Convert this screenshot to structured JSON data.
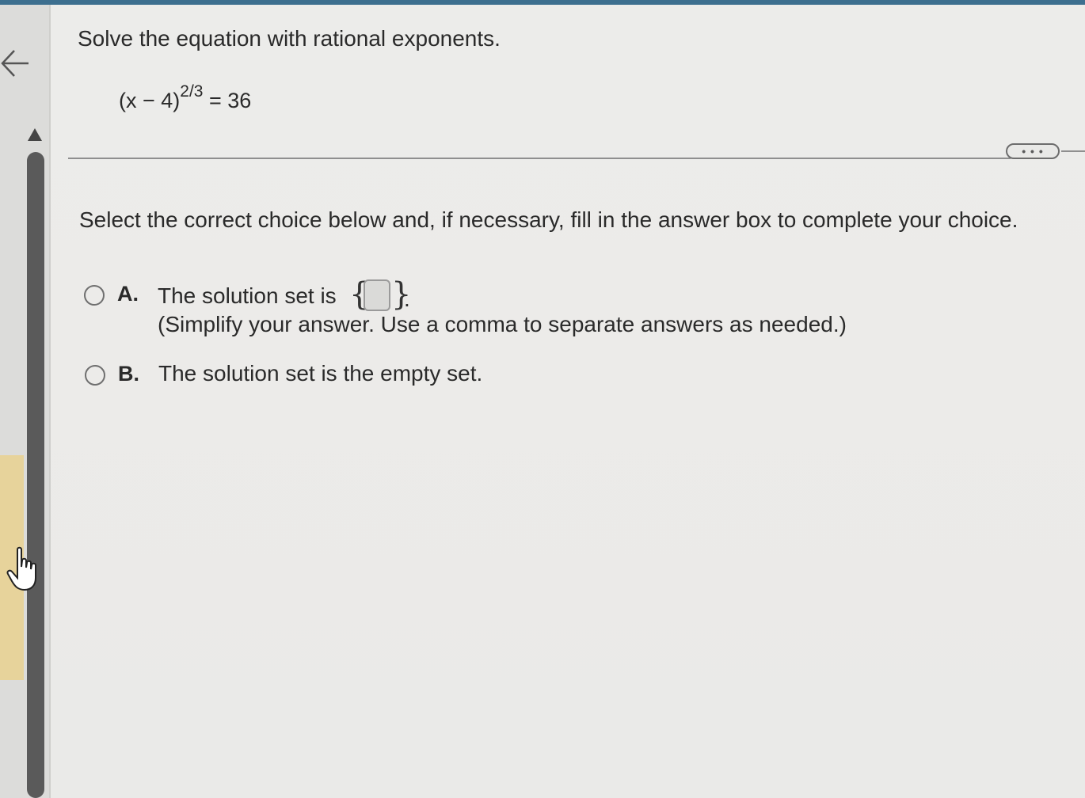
{
  "question": {
    "title": "Solve the equation with rational exponents.",
    "equation_base": "(x − 4)",
    "equation_exponent": "2/3",
    "equation_rhs": "= 36"
  },
  "toolbar": {
    "more_label": "• • •"
  },
  "instruction": "Select the correct choice below and, if necessary, fill in the answer box to complete your choice.",
  "choices": [
    {
      "letter": "A.",
      "text": "The solution set is",
      "brace_open": "{",
      "brace_close": "}",
      "answer_value": "",
      "suffix": ".",
      "hint": "(Simplify your answer. Use a comma to separate answers as needed.)"
    },
    {
      "letter": "B.",
      "text": "The solution set is the empty set."
    }
  ],
  "colors": {
    "top_bar": "#3d6f8f",
    "scrollbar": "#5a5a5a",
    "side_highlight": "#e7d39b"
  },
  "icons": [
    "back-arrow-icon",
    "scroll-up-icon",
    "hand-cursor-icon"
  ]
}
